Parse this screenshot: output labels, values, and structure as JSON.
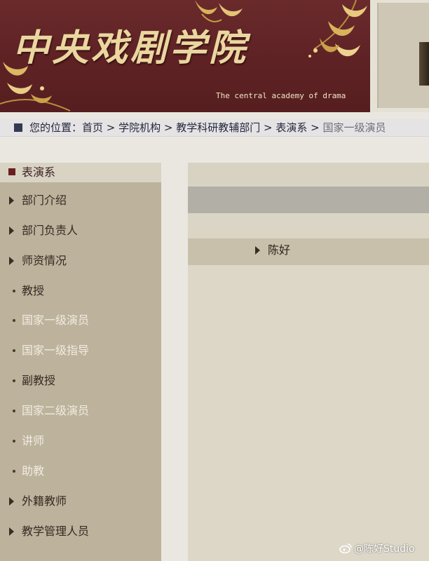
{
  "header": {
    "logo_title": "中央戏剧学院",
    "logo_subtitle": "The central academy of drama"
  },
  "breadcrumb": {
    "prefix": "您的位置：",
    "items": [
      "首页",
      "学院机构",
      "教学科研教辅部门",
      "表演系"
    ],
    "separator": " > ",
    "current": "国家一级演员"
  },
  "sidebar": {
    "heading": "表演系",
    "items": [
      {
        "label": "部门介绍",
        "bullet": "triangle"
      },
      {
        "label": "部门负责人",
        "bullet": "triangle"
      },
      {
        "label": "师资情况",
        "bullet": "triangle"
      },
      {
        "label": "教授",
        "bullet": "dot"
      },
      {
        "label": "国家一级演员",
        "bullet": "dot"
      },
      {
        "label": "国家一级指导",
        "bullet": "dot"
      },
      {
        "label": "副教授",
        "bullet": "dot"
      },
      {
        "label": "国家二级演员",
        "bullet": "dot"
      },
      {
        "label": "讲师",
        "bullet": "dot"
      },
      {
        "label": "助教",
        "bullet": "dot"
      },
      {
        "label": "外籍教师",
        "bullet": "triangle"
      },
      {
        "label": "教学管理人员",
        "bullet": "triangle"
      }
    ]
  },
  "main": {
    "list": [
      "陈好"
    ]
  },
  "watermark": {
    "text": "@陈好Studio"
  },
  "colors": {
    "banner": "#5e2224",
    "sidebar": "#bdb29c",
    "accent_square": "#6a1e22",
    "breadcrumb_square": "#333a52"
  }
}
